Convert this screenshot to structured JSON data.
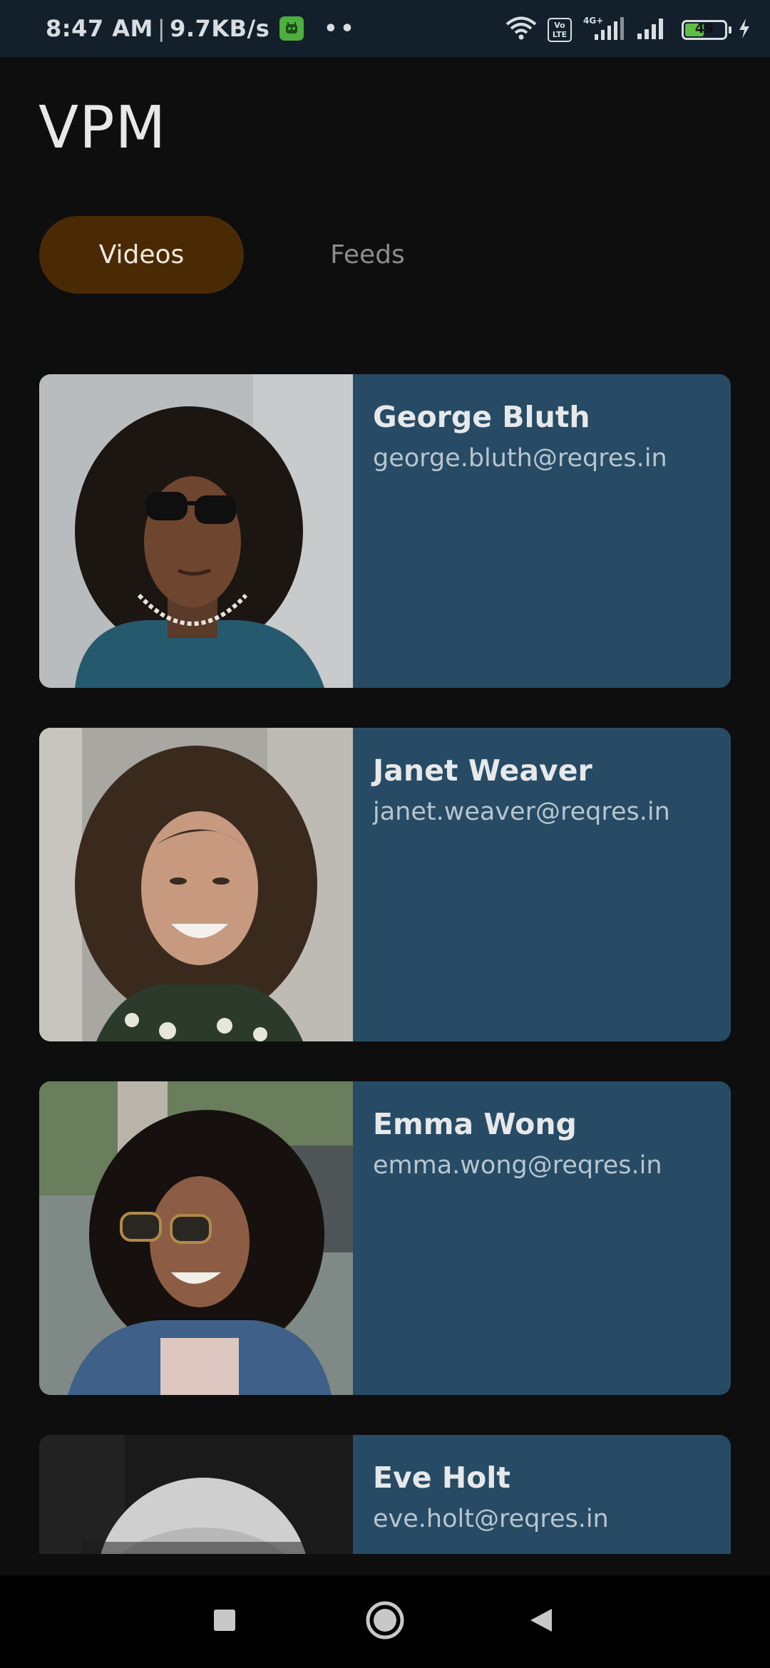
{
  "status_bar": {
    "time": "8:47 AM",
    "network_speed": "9.7KB/s",
    "battery_percent": "49",
    "battery_level": 0.49,
    "icons": [
      "wifi-icon",
      "volte-icon",
      "signal-4g-icon",
      "signal-icon",
      "battery-icon",
      "charging-icon"
    ]
  },
  "header": {
    "title": "VPM"
  },
  "tabs": [
    {
      "label": "Videos",
      "active": true
    },
    {
      "label": "Feeds",
      "active": false
    }
  ],
  "users": [
    {
      "name": "George Bluth",
      "email": "george.bluth@reqres.in"
    },
    {
      "name": "Janet Weaver",
      "email": "janet.weaver@reqres.in"
    },
    {
      "name": "Emma Wong",
      "email": "emma.wong@reqres.in"
    },
    {
      "name": "Eve Holt",
      "email": "eve.holt@reqres.in"
    }
  ],
  "nav": {
    "buttons": [
      "recents-icon",
      "home-icon",
      "back-icon"
    ]
  },
  "colors": {
    "background": "#0e0e0f",
    "card": "#274b64",
    "tab_active": "#4a2a05",
    "status_bar": "#13202c"
  }
}
